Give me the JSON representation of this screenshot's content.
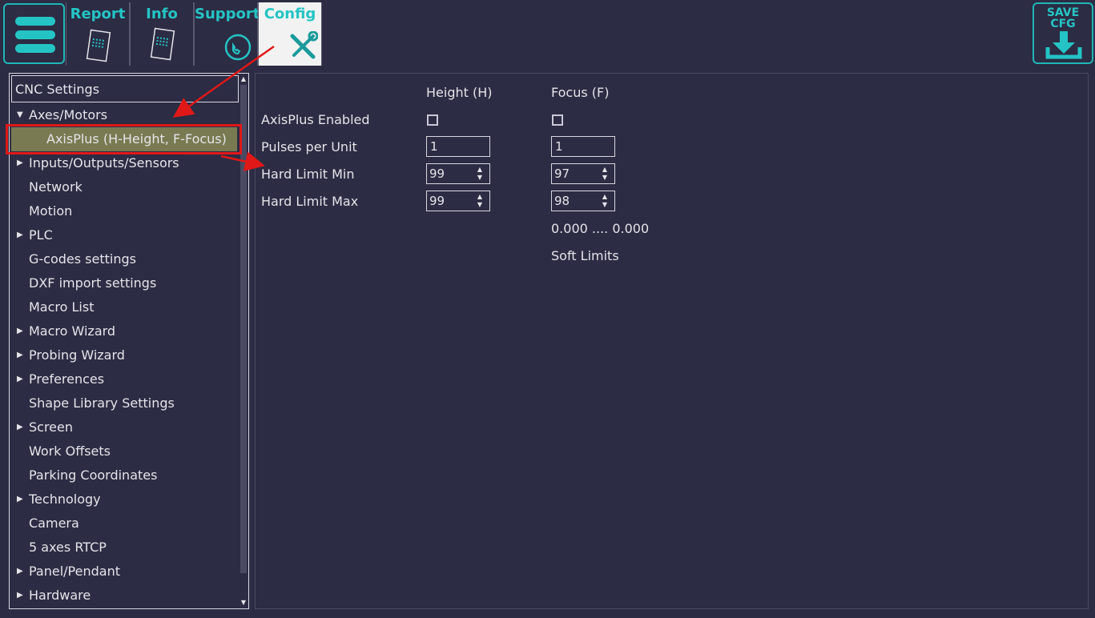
{
  "toolbar": {
    "tabs": [
      {
        "label": "Report",
        "icon": "sd-card-icon"
      },
      {
        "label": "Info",
        "icon": "sd-card-icon"
      },
      {
        "label": "Support",
        "icon": "phone-icon"
      },
      {
        "label": "Config",
        "icon": "tools-icon"
      }
    ],
    "save_line1": "SAVE",
    "save_line2": "CFG",
    "colors": {
      "accent": "#25c4c4",
      "background": "#2c2c44",
      "selected": "#7a7a52",
      "annotation": "#e01818"
    }
  },
  "tree": {
    "header": "CNC Settings",
    "items": [
      {
        "label": "Axes/Motors",
        "arrow": "▼"
      },
      {
        "label": "AxisPlus (H-Height, F-Focus)",
        "arrow": ""
      },
      {
        "label": "Inputs/Outputs/Sensors",
        "arrow": "▶"
      },
      {
        "label": "Network",
        "arrow": ""
      },
      {
        "label": "Motion",
        "arrow": ""
      },
      {
        "label": "PLC",
        "arrow": "▶"
      },
      {
        "label": "G-codes settings",
        "arrow": ""
      },
      {
        "label": "DXF import settings",
        "arrow": ""
      },
      {
        "label": "Macro List",
        "arrow": ""
      },
      {
        "label": "Macro Wizard",
        "arrow": "▶"
      },
      {
        "label": "Probing Wizard",
        "arrow": "▶"
      },
      {
        "label": "Preferences",
        "arrow": "▶"
      },
      {
        "label": "Shape Library Settings",
        "arrow": ""
      },
      {
        "label": "Screen",
        "arrow": "▶"
      },
      {
        "label": "Work Offsets",
        "arrow": ""
      },
      {
        "label": "Parking Coordinates",
        "arrow": ""
      },
      {
        "label": "Technology",
        "arrow": "▶"
      },
      {
        "label": "Camera",
        "arrow": ""
      },
      {
        "label": "5 axes RTCP",
        "arrow": ""
      },
      {
        "label": "Panel/Pendant",
        "arrow": "▶"
      },
      {
        "label": "Hardware",
        "arrow": "▶"
      }
    ]
  },
  "axisplus": {
    "col_height": "Height (H)",
    "col_focus": "Focus (F)",
    "row_enabled": "AxisPlus Enabled",
    "row_pulses": "Pulses per Unit",
    "row_min": "Hard Limit Min",
    "row_max": "Hard Limit Max",
    "height": {
      "pulses": "1",
      "min": "99",
      "max": "99"
    },
    "focus": {
      "pulses": "1",
      "min": "97",
      "max": "98"
    },
    "range_text": "0.000 .... 0.000",
    "soft_limits": "Soft Limits"
  }
}
